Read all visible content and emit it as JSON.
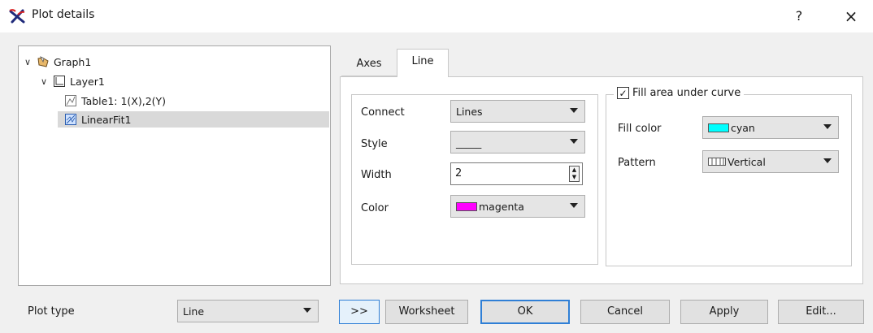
{
  "window": {
    "title": "Plot details",
    "help_glyph": "?",
    "close_glyph": "×"
  },
  "tree": {
    "graph": {
      "label": "Graph1",
      "icon": "graph-folder-icon"
    },
    "layer": {
      "label": "Layer1",
      "icon": "layer-icon"
    },
    "curves": [
      {
        "label": "Table1: 1(X),2(Y)",
        "icon": "plot-curve-icon",
        "selected": false
      },
      {
        "label": "LinearFit1",
        "icon": "fit-curve-icon",
        "selected": true
      }
    ]
  },
  "tabs": [
    {
      "label": "Axes",
      "active": false
    },
    {
      "label": "Line",
      "active": true
    }
  ],
  "line_tab": {
    "connect": {
      "label": "Connect",
      "value": "Lines"
    },
    "style": {
      "label": "Style",
      "value": "_____"
    },
    "width": {
      "label": "Width",
      "value": "2"
    },
    "color": {
      "label": "Color",
      "value": "magenta",
      "swatch": "#ff00ff"
    },
    "fill": {
      "label": "Fill area under curve",
      "checked": true,
      "fill_color": {
        "label": "Fill color",
        "value": "cyan",
        "swatch": "#00ffff"
      },
      "pattern": {
        "label": "Pattern",
        "value": "Vertical"
      }
    }
  },
  "bottom": {
    "plot_type_label": "Plot type",
    "plot_type_value": "Line",
    "expand_label": ">>",
    "worksheet_label": "Worksheet",
    "ok_label": "OK",
    "cancel_label": "Cancel",
    "apply_label": "Apply",
    "edit_label": "Edit..."
  },
  "colors": {
    "accent": "#2f7fd6",
    "selection": "#d9d9d9",
    "dialog_bg": "#f0f0f0"
  }
}
